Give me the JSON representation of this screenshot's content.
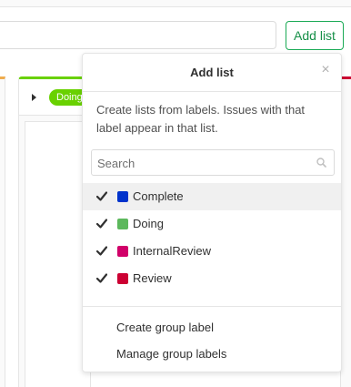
{
  "toolbar": {
    "add_list_label": "Add list"
  },
  "board": {
    "doing_badge": "Doing",
    "colors": {
      "doing": "#69d100",
      "left_list": "#f0ad4e",
      "right_list": "#cc0033",
      "button_border": "#1aaa55"
    }
  },
  "dropdown": {
    "title": "Add list",
    "close_glyph": "×",
    "description": "Create lists from labels. Issues with that label appear in that list.",
    "search_placeholder": "Search",
    "labels": [
      {
        "name": "Complete",
        "color": "#0033cc",
        "checked": true
      },
      {
        "name": "Doing",
        "color": "#5cb85c",
        "checked": true
      },
      {
        "name": "InternalReview",
        "color": "#d10069",
        "checked": true
      },
      {
        "name": "Review",
        "color": "#cc0033",
        "checked": true
      }
    ],
    "footer": {
      "create_label": "Create group label",
      "manage_label": "Manage group labels"
    },
    "icons": {
      "search": "search-icon",
      "check": "check-icon",
      "close": "close-icon",
      "caret": "caret-right-icon"
    }
  }
}
